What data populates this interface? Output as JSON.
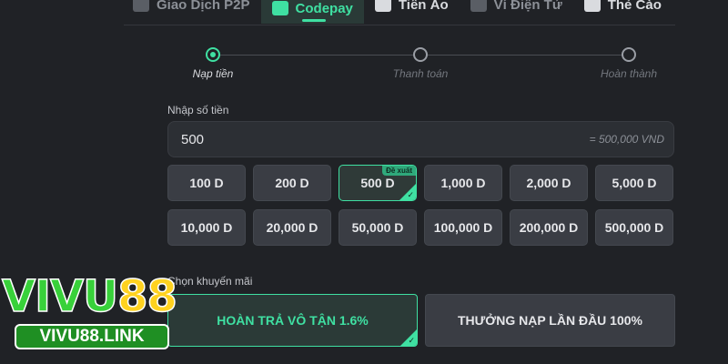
{
  "tabs": [
    {
      "label": "Giao Dịch P2P",
      "icon": "p2p-icon"
    },
    {
      "label": "Codepay",
      "icon": "qr-icon",
      "active": true
    },
    {
      "label": "Tiền Ảo",
      "icon": "crypto-icon"
    },
    {
      "label": "Ví Điện Tử",
      "icon": "wallet-icon"
    },
    {
      "label": "Thẻ Cào",
      "icon": "card-icon"
    }
  ],
  "stepper": {
    "steps": [
      "Nạp tiền",
      "Thanh toán",
      "Hoàn thành"
    ],
    "current": 0
  },
  "amount": {
    "label": "Nhập số tiền",
    "value": "500",
    "conversion": "= 500,000 VND"
  },
  "amount_options": [
    {
      "label": "100 D"
    },
    {
      "label": "200 D"
    },
    {
      "label": "500 D",
      "badge": "Đề xuất",
      "selected": true
    },
    {
      "label": "1,000 D"
    },
    {
      "label": "2,000 D"
    },
    {
      "label": "5,000 D"
    },
    {
      "label": "10,000 D"
    },
    {
      "label": "20,000 D"
    },
    {
      "label": "50,000 D"
    },
    {
      "label": "100,000 D"
    },
    {
      "label": "200,000 D"
    },
    {
      "label": "500,000 D"
    }
  ],
  "promotion": {
    "label": "Chọn khuyến mãi",
    "options": [
      {
        "label": "HOÀN TRẢ VÔ TẬN 1.6%",
        "selected": true
      },
      {
        "label": "THƯỞNG NẠP LẦN ĐẦU 100%"
      }
    ]
  },
  "logo": {
    "text_green": "VIVU",
    "text_yellow": "88",
    "link": "VIVU88.LINK"
  },
  "colors": {
    "accent": "#3fe0a2",
    "background": "#202226",
    "chip": "#3a3d44"
  }
}
